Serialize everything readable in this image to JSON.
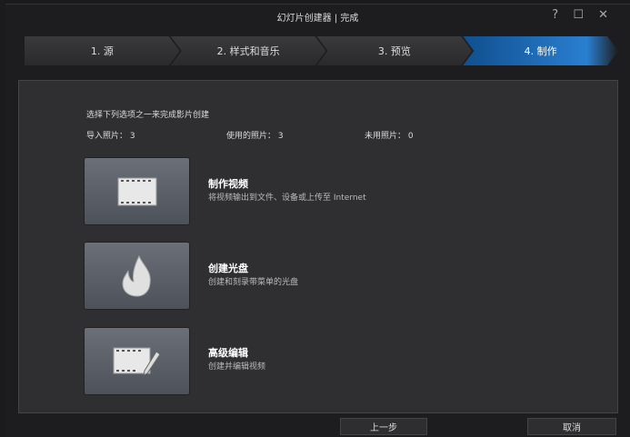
{
  "window": {
    "title": "幻灯片创建器 | 完成",
    "controls": "? ☐ ✕"
  },
  "steps": [
    {
      "label": "1. 源"
    },
    {
      "label": "2. 样式和音乐"
    },
    {
      "label": "3. 预览"
    },
    {
      "label": "4. 制作",
      "active": true
    }
  ],
  "main": {
    "intro": "选择下列选项之一来完成影片创建",
    "stats": {
      "imported": "导入照片： 3",
      "used": "使用的照片： 3",
      "unused": "未用照片： 0"
    },
    "options": [
      {
        "icon": "film-icon",
        "title": "制作视频",
        "desc": "将视频输出到文件、设备或上传至 Internet"
      },
      {
        "icon": "flame-icon",
        "title": "创建光盘",
        "desc": "创建和刻录带菜单的光盘"
      },
      {
        "icon": "film-edit-icon",
        "title": "高级编辑",
        "desc": "创建并编辑视频"
      }
    ]
  },
  "footer": {
    "back": "上一步",
    "cancel": "取消"
  },
  "colors": {
    "accent": "#2a7fd0"
  }
}
